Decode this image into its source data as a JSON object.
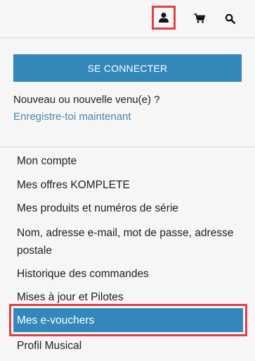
{
  "header": {
    "icons": {
      "account": "user-icon",
      "cart": "cart-icon",
      "search": "search-icon"
    }
  },
  "login": {
    "connect_label": "SE CONNECTER",
    "new_question": "Nouveau ou nouvelle venu(e) ?",
    "register_link": "Enregistre-toi maintenant"
  },
  "menu": {
    "items": [
      {
        "label": "Mon compte"
      },
      {
        "label": "Mes offres KOMPLETE"
      },
      {
        "label": "Mes produits et numéros de série"
      },
      {
        "label": "Nom, adresse e-mail, mot de passe, adresse postale"
      },
      {
        "label": "Historique des commandes"
      },
      {
        "label": "Mises à jour et Pilotes"
      },
      {
        "label": "Mes e-vouchers"
      },
      {
        "label": "Profil Musical"
      }
    ],
    "active_index": 6
  },
  "colors": {
    "accent": "#3388bb",
    "link": "#4d86ad",
    "highlight": "#e0403f"
  }
}
